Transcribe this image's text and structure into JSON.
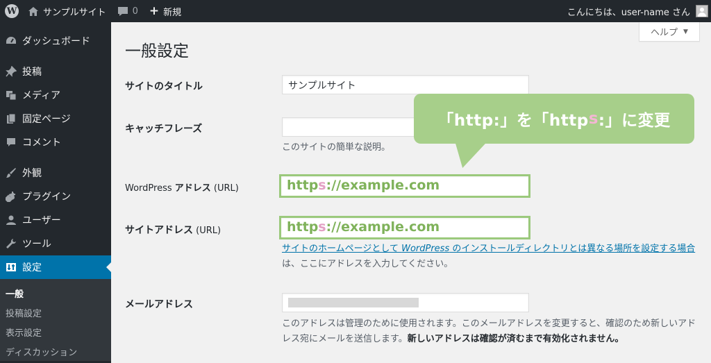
{
  "adminbar": {
    "site_name": "サンプルサイト",
    "comments_count": "0",
    "new_label": "新規",
    "greeting": "こんにちは、user-name さん"
  },
  "sidebar": {
    "items": [
      {
        "label": "ダッシュボード",
        "icon": "dashboard-icon"
      },
      {
        "label": "投稿",
        "icon": "pin-icon"
      },
      {
        "label": "メディア",
        "icon": "media-icon"
      },
      {
        "label": "固定ページ",
        "icon": "page-icon"
      },
      {
        "label": "コメント",
        "icon": "comment-icon"
      },
      {
        "label": "外観",
        "icon": "brush-icon"
      },
      {
        "label": "プラグイン",
        "icon": "plugin-icon"
      },
      {
        "label": "ユーザー",
        "icon": "user-icon"
      },
      {
        "label": "ツール",
        "icon": "wrench-icon"
      },
      {
        "label": "設定",
        "icon": "settings-icon"
      }
    ],
    "submenu": [
      "一般",
      "投稿設定",
      "表示設定",
      "ディスカッション"
    ]
  },
  "main": {
    "help_label": "ヘルプ",
    "title": "一般設定",
    "site_title_label": "サイトのタイトル",
    "site_title_value": "サンプルサイト",
    "tagline_label": "キャッチフレーズ",
    "tagline_value": "",
    "tagline_desc": "このサイトの簡単な説明。",
    "wp_address_label_a": "WordPress ",
    "wp_address_label_b": "アドレス",
    "wp_address_label_c": " (URL)",
    "site_address_label_a": "サイトアドレス",
    "site_address_label_b": " (URL)",
    "url_prefix": "http",
    "url_s": "s",
    "url_rest": "://example.com",
    "site_address_desc_link_a": "サイトのホームページとして ",
    "site_address_desc_link_em": "WordPress",
    "site_address_desc_link_b": " のインストールディレクトリとは異なる場所を設定する場合",
    "site_address_desc_rest": "は、ここにアドレスを入力してください。",
    "email_label": "メールアドレス",
    "email_desc_a": "このアドレスは管理のために使用されます。このメールアドレスを変更すると、確認のため新しいアドレス宛にメールを送信します。",
    "email_desc_b": "新しいアドレスは確認が済むまで有効化されません。"
  },
  "callout": {
    "part_a": "「http:」を「http",
    "part_s": "s",
    "part_b": ":」に変更"
  },
  "colors": {
    "callout_green": "#a7cf8a",
    "url_green": "#7fb25a",
    "highlight_pink": "#e3a0c4",
    "wp_blue": "#0073aa"
  }
}
